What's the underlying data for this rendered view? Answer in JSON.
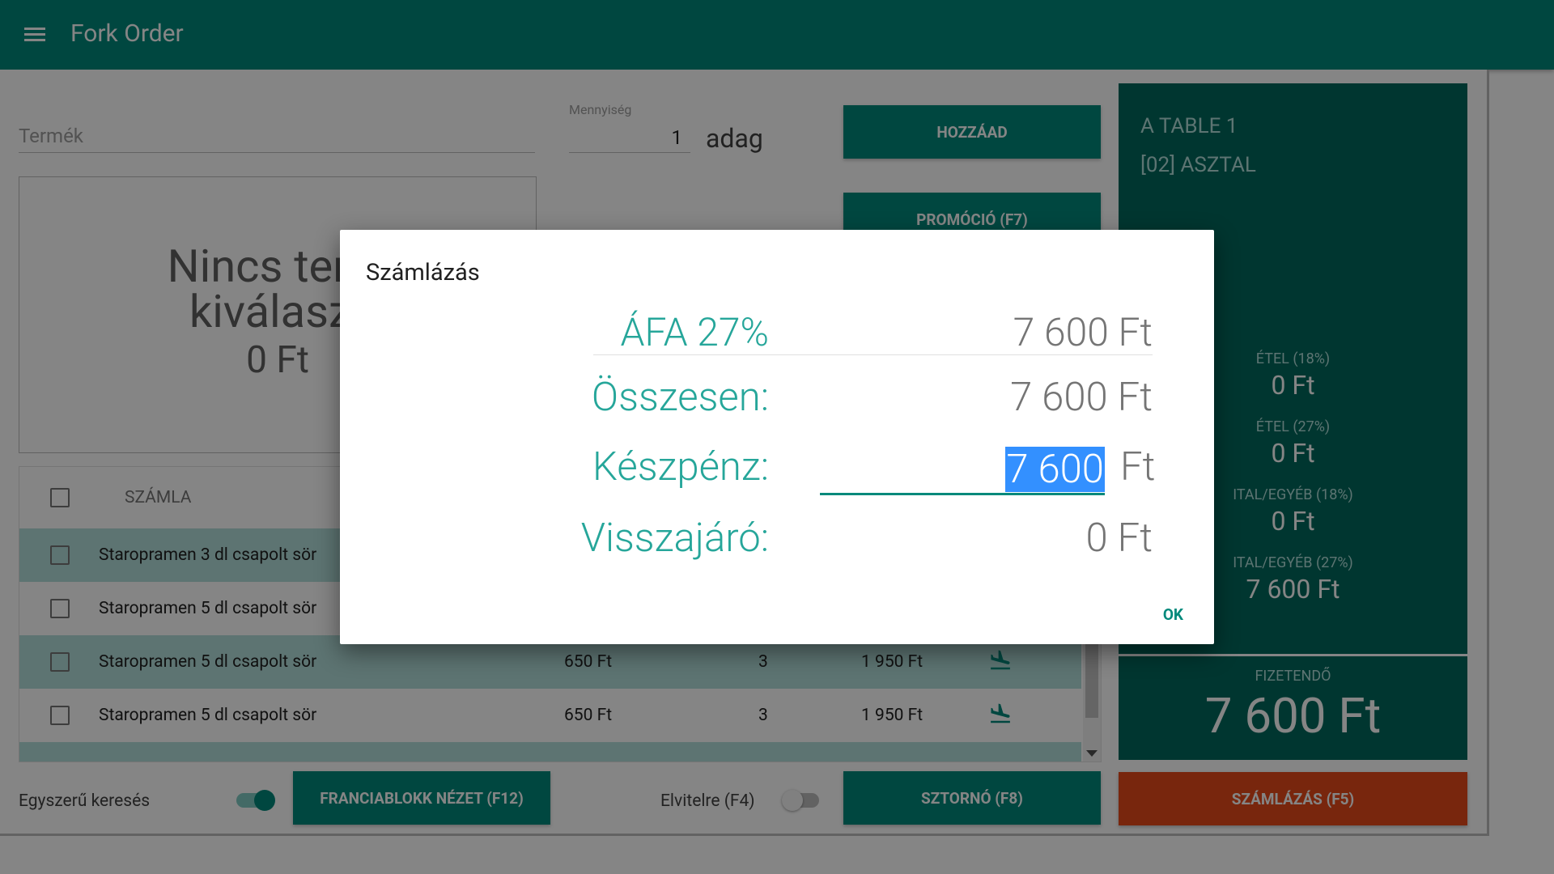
{
  "app": {
    "title": "Fork Order"
  },
  "form": {
    "product_placeholder": "Termék",
    "quantity_label": "Mennyiség",
    "quantity_value": "1",
    "unit": "adag",
    "add_button": "HOZZÁAD",
    "promo_button": "PROMÓCIÓ (F7)"
  },
  "product_panel": {
    "line1": "Nincs term",
    "line2": "kiválaszt",
    "price": "0 Ft"
  },
  "table": {
    "header_label": "SZÁMLA",
    "rows": [
      {
        "name": "Staropramen 3 dl csapolt sör",
        "price": "",
        "qty": "",
        "total": ""
      },
      {
        "name": "Staropramen 5 dl csapolt sör",
        "price": "",
        "qty": "",
        "total": ""
      },
      {
        "name": "Staropramen 5 dl csapolt sör",
        "price": "650 Ft",
        "qty": "3",
        "total": "1 950 Ft"
      },
      {
        "name": "Staropramen 5 dl csapolt sör",
        "price": "650 Ft",
        "qty": "3",
        "total": "1 950 Ft"
      }
    ]
  },
  "bottom_bar": {
    "simple_search_label": "Egyszerű keresés",
    "simple_search_on": true,
    "french_button": "FRANCIABLOKK NÉZET (F12)",
    "takeaway_label": "Elvitelre (F4)",
    "takeaway_on": false,
    "storno_button": "SZTORNÓ (F8)",
    "billing_button": "SZÁMLÁZÁS (F5)"
  },
  "side_panel": {
    "table_name": "A TABLE 1",
    "table_id": "[02] ASZTAL",
    "categories": [
      {
        "label": "ÉTEL (18%)",
        "value": "0 Ft"
      },
      {
        "label": "ÉTEL (27%)",
        "value": "0 Ft"
      },
      {
        "label": "ITAL/EGYÉB (18%)",
        "value": "0 Ft"
      },
      {
        "label": "ITAL/EGYÉB (27%)",
        "value": "7 600 Ft"
      }
    ],
    "payable_label": "FIZETENDŐ",
    "payable_value": "7 600 Ft"
  },
  "dialog": {
    "title": "Számlázás",
    "vat_label": "ÁFA 27%",
    "vat_value": "7 600 Ft",
    "total_label": "Összesen:",
    "total_value": "7 600 Ft",
    "cash_label": "Készpénz:",
    "cash_input": "7 600",
    "cash_unit": "Ft",
    "change_label": "Visszajáró:",
    "change_value": "0 Ft",
    "ok_button": "OK"
  },
  "colors": {
    "primary": "#00897b",
    "primary_dark": "#00695c",
    "accent": "#26a69a",
    "billing": "#e64a19",
    "selection": "#3390ff"
  }
}
